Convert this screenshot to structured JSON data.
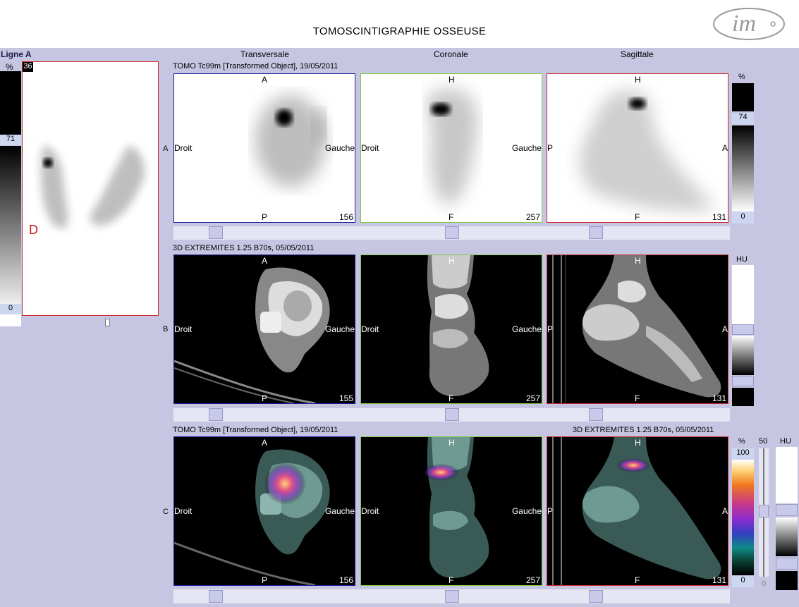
{
  "header": {
    "title": "TOMOSCINTIGRAPHIE OSSEUSE",
    "logo_text": "im"
  },
  "left": {
    "line_label": "Ligne A",
    "percent_label": "%",
    "slice_badge": "36",
    "scale_mid": "71",
    "scale_min": "0",
    "side_marker": "D"
  },
  "columns": [
    "Transversale",
    "Coronale",
    "Sagittale"
  ],
  "row_labels": [
    "A",
    "B",
    "C"
  ],
  "rowA": {
    "series": "TOMO Tc99m [Transformed Object], 19/05/2011",
    "panels": [
      {
        "top": "A",
        "left": "Droit",
        "right": "Gauche",
        "bottom": "P",
        "slice": "156"
      },
      {
        "top": "H",
        "left": "Droit",
        "right": "Gauche",
        "bottom": "F",
        "slice": "257"
      },
      {
        "top": "H",
        "left": "P",
        "right": "A",
        "bottom": "F",
        "slice": "131"
      }
    ],
    "scale_unit": "%",
    "scale_max": "74",
    "scale_min": "0"
  },
  "rowB": {
    "series": "3D EXTREMITES  1.25  B70s, 05/05/2011",
    "panels": [
      {
        "top": "A",
        "left": "Droit",
        "right": "Gauche",
        "bottom": "P",
        "slice": "155"
      },
      {
        "top": "H",
        "left": "Droit",
        "right": "Gauche",
        "bottom": "F",
        "slice": "257"
      },
      {
        "top": "H",
        "left": "P",
        "right": "A",
        "bottom": "F",
        "slice": "131"
      }
    ],
    "scale_unit": "HU"
  },
  "rowC": {
    "series_left": "TOMO Tc99m [Transformed Object], 19/05/2011",
    "series_right": "3D EXTREMITES  1.25  B70s, 05/05/2011",
    "panels": [
      {
        "top": "A",
        "left": "Droit",
        "right": "Gauche",
        "bottom": "P",
        "slice": "156"
      },
      {
        "top": "H",
        "left": "Droit",
        "right": "Gauche",
        "bottom": "F",
        "slice": "257"
      },
      {
        "top": "H",
        "left": "P",
        "right": "A",
        "bottom": "F",
        "slice": "131"
      }
    ],
    "scale_unit": "%",
    "scale_max": "100",
    "scale_min": "0",
    "blend_label": "50",
    "blend_min": "0",
    "hu_unit": "HU"
  },
  "colors": {
    "background": "#c6c6e2",
    "transversal_border": "#1f1f9a",
    "coronal_border": "#7ccc44",
    "sagittal_border": "#cc2a2a",
    "marker_red": "#cc1a1a"
  }
}
